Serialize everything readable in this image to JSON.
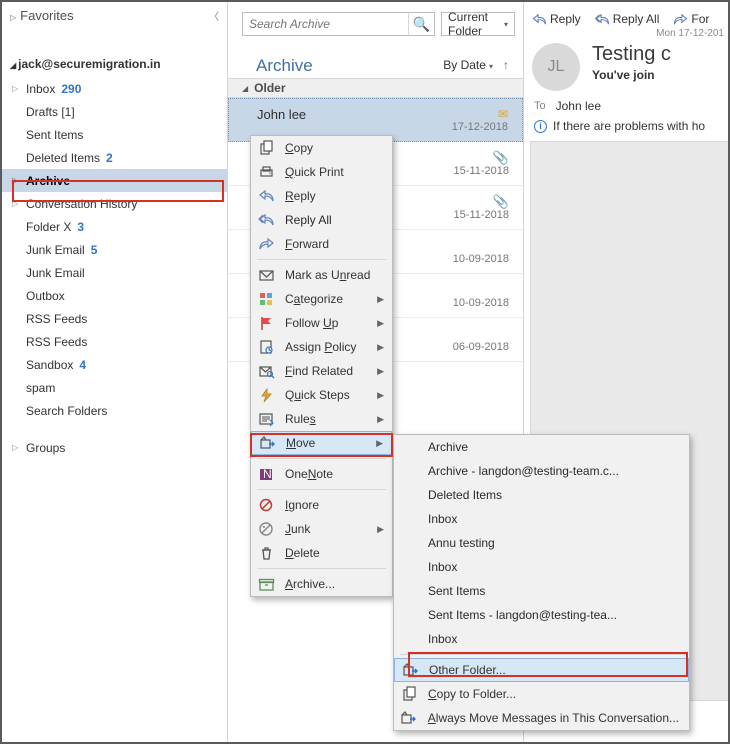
{
  "nav": {
    "favorites_label": "Favorites",
    "account": "jack@securemigration.in",
    "folders": [
      {
        "name": "Inbox",
        "badge": "290",
        "exp": true
      },
      {
        "name": "Drafts [1]"
      },
      {
        "name": "Sent Items"
      },
      {
        "name": "Deleted Items",
        "badge": "2"
      },
      {
        "name": "Archive",
        "sel": true,
        "exp": true
      },
      {
        "name": "Conversation History",
        "exp": true
      },
      {
        "name": "Folder X",
        "badge": "3"
      },
      {
        "name": "Junk Email",
        "badge": "5"
      },
      {
        "name": "Junk Email"
      },
      {
        "name": "Outbox"
      },
      {
        "name": "RSS Feeds"
      },
      {
        "name": "RSS Feeds"
      },
      {
        "name": "Sandbox",
        "badge": "4"
      },
      {
        "name": "spam"
      },
      {
        "name": "Search Folders"
      }
    ],
    "groups_label": "Groups"
  },
  "search": {
    "placeholder": "Search Archive",
    "scope": "Current Folder"
  },
  "folderTitle": "Archive",
  "sort": {
    "label": "By Date"
  },
  "group": {
    "label": "Older"
  },
  "messages": [
    {
      "sender": "John lee",
      "date": "17-12-2018",
      "envelope": true,
      "sel": true
    },
    {
      "sender": "",
      "date": "15-11-2018",
      "clip": true
    },
    {
      "sender": "",
      "date": "15-11-2018",
      "clip": true
    },
    {
      "sender": "",
      "date": "10-09-2018"
    },
    {
      "sender": "",
      "date": "10-09-2018"
    },
    {
      "sender": "",
      "date": "06-09-2018"
    }
  ],
  "context": {
    "items": [
      {
        "id": "copy",
        "label": "Copy",
        "u": "C",
        "icon": "copy"
      },
      {
        "id": "quickprint",
        "label": "Quick Print",
        "u": "Q",
        "icon": "quickprint"
      },
      {
        "id": "reply",
        "label": "Reply",
        "u": "R",
        "icon": "reply"
      },
      {
        "id": "replyall",
        "label": "Reply All",
        "icon": "replyall"
      },
      {
        "id": "forward",
        "label": "Forward",
        "u": "F",
        "icon": "forward"
      },
      {
        "sep": true
      },
      {
        "id": "markunread",
        "label": "Mark as Unread",
        "u": "n",
        "icon": "envelope"
      },
      {
        "id": "categorize",
        "label": "Categorize",
        "u": "a",
        "icon": "categorize",
        "sub": true
      },
      {
        "id": "followup",
        "label": "Follow Up",
        "u": "U",
        "icon": "flag",
        "sub": true
      },
      {
        "id": "assignpolicy",
        "label": "Assign Policy",
        "u": "P",
        "icon": "policy",
        "sub": true
      },
      {
        "id": "findrelated",
        "label": "Find Related",
        "u": "F",
        "icon": "find",
        "sub": true
      },
      {
        "id": "quicksteps",
        "label": "Quick Steps",
        "u": "u",
        "icon": "bolt",
        "sub": true
      },
      {
        "id": "rules",
        "label": "Rules",
        "u": "s",
        "icon": "rules",
        "sub": true
      },
      {
        "id": "move",
        "label": "Move",
        "u": "M",
        "icon": "move",
        "sub": true,
        "sel": true
      },
      {
        "sep": true
      },
      {
        "id": "onenote",
        "label": "OneNote",
        "u": "N",
        "icon": "onenote"
      },
      {
        "sep": true
      },
      {
        "id": "ignore",
        "label": "Ignore",
        "u": "I",
        "icon": "ignore"
      },
      {
        "id": "junk",
        "label": "Junk",
        "u": "J",
        "icon": "junk",
        "sub": true
      },
      {
        "id": "delete",
        "label": "Delete",
        "u": "D",
        "icon": "delete"
      },
      {
        "sep": true
      },
      {
        "id": "archive",
        "label": "Archive...",
        "u": "A",
        "icon": "archivebox"
      }
    ]
  },
  "moveSub": {
    "items": [
      {
        "label": "Archive"
      },
      {
        "label": "Archive - langdon@testing-team.c..."
      },
      {
        "label": "Deleted Items"
      },
      {
        "label": "Inbox"
      },
      {
        "label": "Annu testing"
      },
      {
        "label": "Inbox"
      },
      {
        "label": "Sent Items"
      },
      {
        "label": "Sent Items - langdon@testing-tea..."
      },
      {
        "label": "Inbox"
      },
      {
        "sep": true
      },
      {
        "label": "Other Folder...",
        "u": "O",
        "sel": true,
        "icon": "move"
      },
      {
        "label": "Copy to Folder...",
        "u": "C",
        "icon": "copy"
      },
      {
        "label": "Always Move Messages in This Conversation...",
        "u": "A",
        "icon": "move"
      }
    ]
  },
  "reading": {
    "reply": "Reply",
    "replyAll": "Reply All",
    "forward": "For",
    "datestamp": "Mon 17-12-201",
    "avatar": "JL",
    "subject": "Testing c",
    "subhead": "You've join",
    "toLabel": "To",
    "toName": "John lee",
    "info": "If there are problems with ho"
  }
}
